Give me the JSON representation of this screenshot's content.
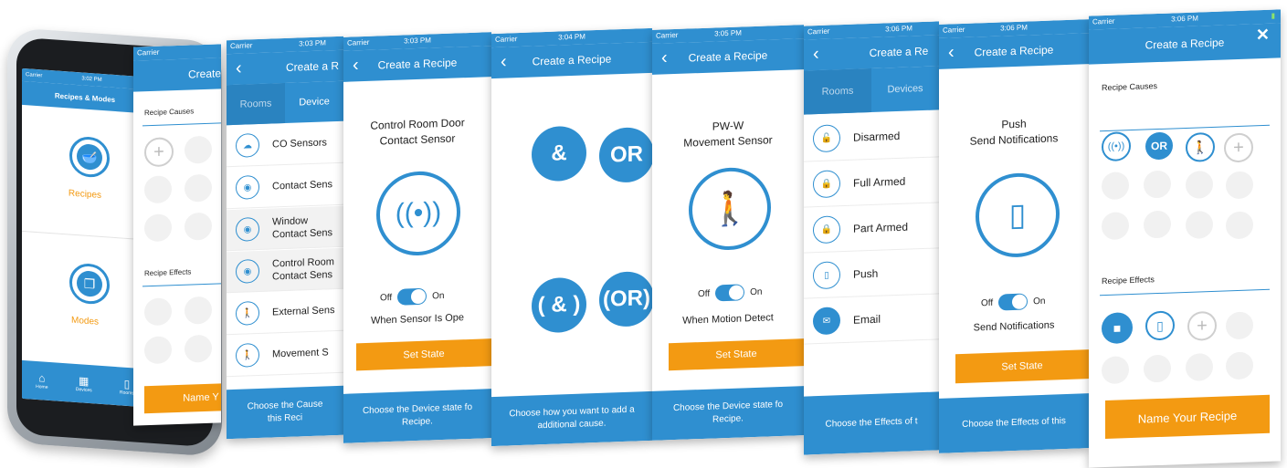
{
  "phone": {
    "carrier": "Carrier",
    "time": "3:02 PM",
    "header": "Recipes & Modes",
    "tiles": [
      {
        "label": "Recipes"
      },
      {
        "label": "Modes"
      }
    ],
    "nav": [
      {
        "label": "Home"
      },
      {
        "label": "Devices"
      },
      {
        "label": "Rooms"
      }
    ]
  },
  "screen1": {
    "carrier": "Carrier",
    "title": "Create",
    "causes_label": "Recipe Causes",
    "effects_label": "Recipe Effects",
    "name_button": "Name Y"
  },
  "screen2": {
    "carrier": "Carrier",
    "time": "3:03 PM",
    "title": "Create a R",
    "tabs": [
      {
        "label": "Rooms"
      },
      {
        "label": "Device"
      }
    ],
    "rows": [
      {
        "icon": "cloud-sensor-icon",
        "label": "CO Sensors",
        "label2": ""
      },
      {
        "icon": "contact-sensor-icon",
        "label": "Contact Sens",
        "label2": ""
      },
      {
        "icon": "window-sensor-icon",
        "label": "Window",
        "label2": "Contact Sens"
      },
      {
        "icon": "door-sensor-icon",
        "label": "Control Room",
        "label2": "Contact Sens"
      },
      {
        "icon": "external-sensor-icon",
        "label": "External Sens",
        "label2": ""
      },
      {
        "icon": "movement-sensor-icon",
        "label": "Movement S",
        "label2": ""
      }
    ],
    "footer_line1": "Choose the Cause",
    "footer_line2": "this Reci"
  },
  "screen3": {
    "carrier": "Carrier",
    "time": "3:03 PM",
    "title": "Create a Recipe",
    "device_line1": "Control Room Door",
    "device_line2": "Contact Sensor",
    "off": "Off",
    "on": "On",
    "state_label": "When Sensor Is Ope",
    "set_state": "Set State",
    "footer_line1": "Choose the Device state fo",
    "footer_line2": "Recipe."
  },
  "screen4": {
    "carrier": "Carrier",
    "time": "3:04 PM",
    "title": "Create a Recipe",
    "ops": [
      "&",
      "OR",
      "( & )",
      "(OR)"
    ],
    "footer_line1": "Choose how you want to add a",
    "footer_line2": "additional cause."
  },
  "screen5": {
    "carrier": "Carrier",
    "time": "3:05 PM",
    "title": "Create a Recipe",
    "device_line1": "PW-W",
    "device_line2": "Movement Sensor",
    "off": "Off",
    "on": "On",
    "state_label": "When Motion Detect",
    "set_state": "Set State",
    "footer_line1": "Choose the Device state fo",
    "footer_line2": "Recipe."
  },
  "screen6": {
    "carrier": "Carrier",
    "time": "3:06 PM",
    "title": "Create a Re",
    "tabs": [
      {
        "label": "Rooms"
      },
      {
        "label": "Devices"
      }
    ],
    "rows": [
      {
        "icon": "unlock-icon",
        "label": "Disarmed"
      },
      {
        "icon": "lock-icon",
        "label": "Full Armed"
      },
      {
        "icon": "partial-lock-icon",
        "label": "Part Armed"
      },
      {
        "icon": "phone-push-icon",
        "label": "Push"
      },
      {
        "icon": "email-icon",
        "label": "Email"
      }
    ],
    "footer_line1": "Choose the Effects of t"
  },
  "screen7": {
    "carrier": "Carrier",
    "time": "3:06 PM",
    "title": "Create a Recipe",
    "device_line1": "Push",
    "device_line2": "Send Notifications",
    "off": "Off",
    "on": "On",
    "state_label": "Send Notifications",
    "set_state": "Set State",
    "footer_line1": "Choose the Effects of this"
  },
  "screen8": {
    "carrier": "Carrier",
    "time": "3:06 PM",
    "title": "Create a Recipe",
    "causes_label": "Recipe Causes",
    "effects_label": "Recipe Effects",
    "or": "OR",
    "name_button": "Name Your Recipe"
  }
}
